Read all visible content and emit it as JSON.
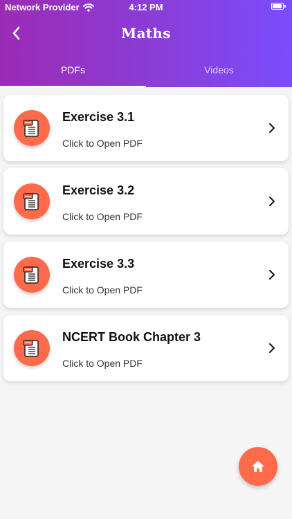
{
  "status_bar": {
    "carrier": "Network Provider",
    "time": "4:12 PM"
  },
  "app": {
    "title": "Maths"
  },
  "tabs": [
    {
      "label": "PDFs",
      "active": true
    },
    {
      "label": "Videos",
      "active": false
    }
  ],
  "items": [
    {
      "title": "Exercise 3.1",
      "subtitle": "Click to Open PDF",
      "icon": "pdf-document-icon"
    },
    {
      "title": "Exercise 3.2",
      "subtitle": "Click to Open PDF",
      "icon": "pdf-document-icon"
    },
    {
      "title": "Exercise 3.3",
      "subtitle": "Click to Open PDF",
      "icon": "pdf-document-icon"
    },
    {
      "title": "NCERT Book Chapter 3",
      "subtitle": "Click to Open PDF",
      "icon": "pdf-document-icon"
    }
  ],
  "fab": {
    "icon": "home-icon"
  },
  "colors": {
    "header_gradient_start": "#9b2bb5",
    "header_gradient_end": "#7b4cff",
    "accent": "#ff6a4a",
    "background": "#f5f5f5",
    "card": "#ffffff"
  }
}
